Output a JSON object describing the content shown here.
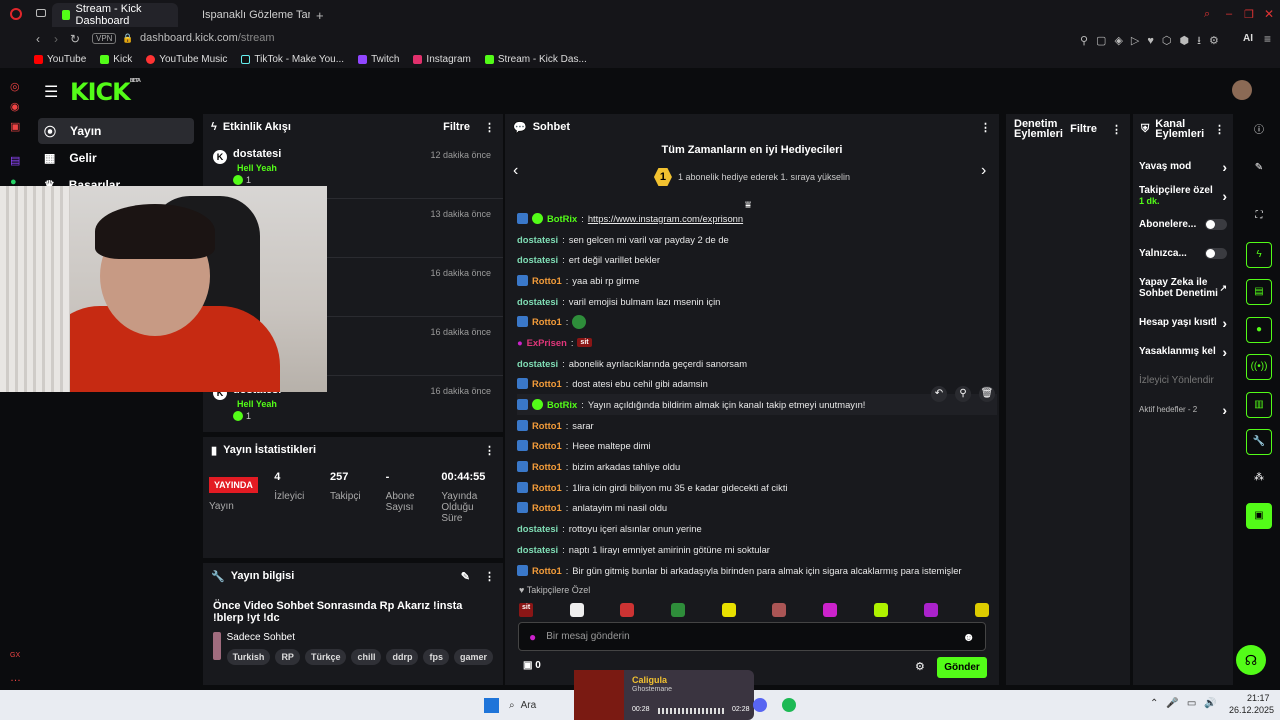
{
  "browser": {
    "tabs": [
      {
        "label": "Stream - Kick Dashboard",
        "active": true
      },
      {
        "label": "Ispanaklı Gözleme Tarifi: P",
        "active": false
      }
    ],
    "vpn_label": "VPN",
    "url_host": "dashboard.kick.com",
    "url_path": "/stream",
    "ai_label": "AI",
    "bookmarks": [
      "YouTube",
      "Kick",
      "YouTube Music",
      "TikTok - Make You...",
      "Twitch",
      "Instagram",
      "Stream - Kick Das..."
    ]
  },
  "nav": {
    "items": [
      "Yayın",
      "Gelir",
      "Başarılar"
    ]
  },
  "activity": {
    "title": "Etkinlik Akışı",
    "filter": "Filtre",
    "events": [
      {
        "user": "dostatesi",
        "time": "12 dakika önce",
        "msg": "Hell Yeah",
        "count": "1"
      },
      {
        "user": "",
        "time": "13 dakika önce",
        "msg": "",
        "count": ""
      },
      {
        "user": "",
        "time": "16 dakika önce",
        "msg": "",
        "count": ""
      },
      {
        "user": "",
        "time": "16 dakika önce",
        "msg": "",
        "count": ""
      },
      {
        "user": "dostatesi",
        "time": "16 dakika önce",
        "msg": "Hell Yeah",
        "count": "1"
      }
    ]
  },
  "stats": {
    "title": "Yayın İstatistikleri",
    "live_badge": "YAYINDA",
    "live_label": "Yayın",
    "items": [
      {
        "value": "4",
        "label": "İzleyici"
      },
      {
        "value": "257",
        "label": "Takipçi"
      },
      {
        "value": "-",
        "label": "Abone Sayısı"
      },
      {
        "value": "00:44:55",
        "label": "Yayında Olduğu Süre"
      }
    ]
  },
  "info": {
    "title": "Yayın bilgisi",
    "stream_title": "Önce Video Sohbet Sonrasında Rp Akarız !insta !blerp !yt !dc",
    "category": "Sadece Sohbet",
    "tags": [
      "Turkish",
      "RP",
      "Türkçe",
      "chill",
      "ddrp",
      "fps",
      "gamer"
    ]
  },
  "chat": {
    "title": "Sohbet",
    "gift_title": "Tüm Zamanların en iyi Hediyecileri",
    "gift_rank": "1",
    "gift_sub": "1 abonelik hediye ederek 1. sıraya yükselin",
    "messages": [
      {
        "user": "BotRix",
        "text": "https://www.instagram.com/exprisonn",
        "color": "#53fc18",
        "badge": "bot"
      },
      {
        "user": "dostatesi",
        "text": "sen gelcen mi varil var payday 2 de de",
        "color": "#7fdcb4",
        "badge": "none"
      },
      {
        "user": "dostatesi",
        "text": "ert değil varillet bekler",
        "color": "#7fdcb4",
        "badge": "none"
      },
      {
        "user": "Rotto1",
        "text": "yaa abi rp girme",
        "color": "#f39c3a",
        "badge": "mod"
      },
      {
        "user": "dostatesi",
        "text": "varil emojisi bulmam lazı msenin için",
        "color": "#7fdcb4",
        "badge": "none"
      },
      {
        "user": "Rotto1",
        "text": "",
        "color": "#f39c3a",
        "badge": "mod",
        "emoji": true
      },
      {
        "user": "ExPrisen",
        "text": "",
        "color": "#e0367a",
        "badge": "mic",
        "sit": "sit"
      },
      {
        "user": "dostatesi",
        "text": "abonelik ayrılacıklarında geçerdi sanorsam",
        "color": "#7fdcb4",
        "badge": "none"
      },
      {
        "user": "Rotto1",
        "text": "dost atesi ebu cehil gibi adamsin",
        "color": "#f39c3a",
        "badge": "mod"
      },
      {
        "user": "BotRix",
        "text": "Yayın açıldığında bildirim almak için kanalı takip etmeyi unutmayın!",
        "color": "#53fc18",
        "badge": "bot",
        "highlight": true
      },
      {
        "user": "Rotto1",
        "text": "sarar",
        "color": "#f39c3a",
        "badge": "mod"
      },
      {
        "user": "Rotto1",
        "text": "Heee maltepe dimi",
        "color": "#f39c3a",
        "badge": "mod"
      },
      {
        "user": "Rotto1",
        "text": "bizim arkadas tahliye oldu",
        "color": "#f39c3a",
        "badge": "mod"
      },
      {
        "user": "Rotto1",
        "text": "1lira icin girdi biliyon mu 35 e kadar gidecekti af cikti",
        "color": "#f39c3a",
        "badge": "mod"
      },
      {
        "user": "Rotto1",
        "text": "anlatayim mi nasil oldu",
        "color": "#f39c3a",
        "badge": "mod"
      },
      {
        "user": "dostatesi",
        "text": "rottoyu içeri alsınlar onun yerine",
        "color": "#7fdcb4",
        "badge": "none"
      },
      {
        "user": "dostatesi",
        "text": "naptı 1 lirayı emniyet amirinin götüne mi soktular",
        "color": "#7fdcb4",
        "badge": "none"
      },
      {
        "user": "Rotto1",
        "text": "Bir gün gitmiş bunlar bi arkadaşıyla birinden para almak için sigara alcaklarmış para istemişler",
        "color": "#f39c3a",
        "badge": "mod"
      }
    ],
    "followers_only": "Takipçilere Özel",
    "emote_sit": "sit",
    "input_placeholder": "Bir mesaj gönderin",
    "points": "0",
    "send_label": "Gönder"
  },
  "moderation": {
    "title": "Denetim Eylemleri",
    "filter": "Filtre"
  },
  "channel": {
    "title": "Kanal Eylemleri",
    "items": [
      {
        "label": "Yavaş mod",
        "sub": "",
        "control": "chevron"
      },
      {
        "label": "Takipçilere özel",
        "sub": "1 dk.",
        "control": "chevron"
      },
      {
        "label": "Abonelere...",
        "sub": "",
        "control": "toggle"
      },
      {
        "label": "Yalnızca...",
        "sub": "",
        "control": "toggle"
      },
      {
        "label": "Yapay Zeka ile Sohbet Denetimi",
        "sub": "",
        "control": "external"
      },
      {
        "label": "Hesap yaşı kısıtl",
        "sub": "",
        "control": "chevron"
      },
      {
        "label": "Yasaklanmış kel",
        "sub": "",
        "control": "chevron"
      },
      {
        "label": "İzleyici Yönlendir",
        "sub": "",
        "control": "none"
      },
      {
        "label": "Aktif hedefler - 2",
        "sub": "",
        "control": "chevron"
      }
    ]
  },
  "taskbar": {
    "search_label": "Ara",
    "media_title": "Caligula",
    "media_artist": "Ghostemane",
    "media_elapsed": "00:28",
    "media_total": "02:28",
    "clock_time": "21:17",
    "clock_date": "26.12.2025"
  },
  "colors": {
    "accent": "#53fc18",
    "live": "#e31b23"
  }
}
